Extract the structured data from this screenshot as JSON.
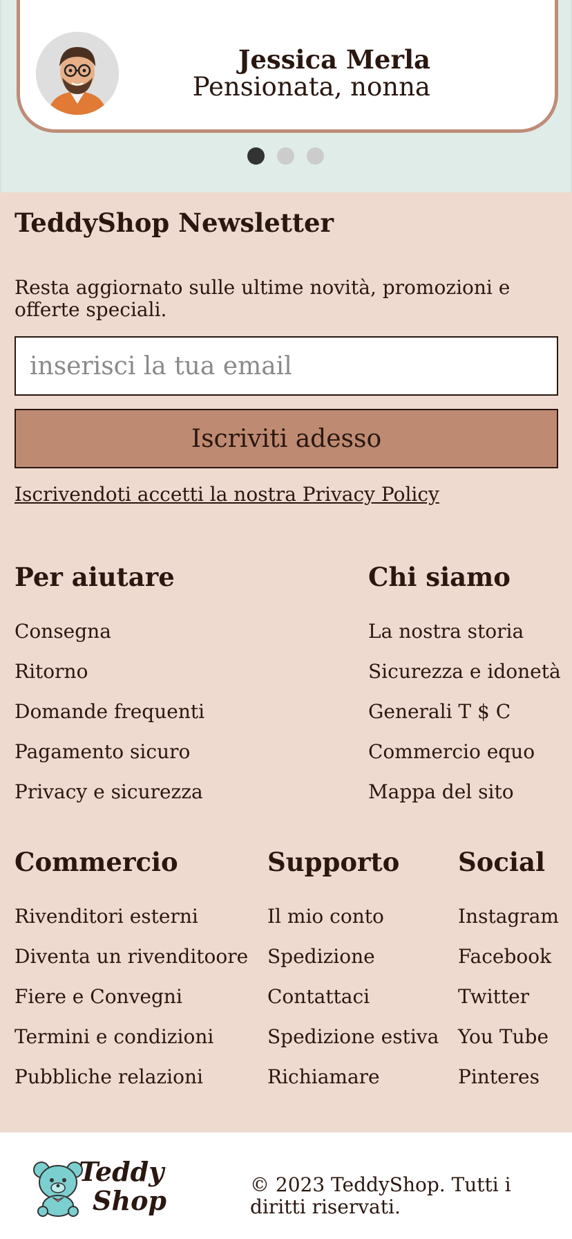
{
  "testimonial": {
    "name": "Jessica Merla",
    "role": "Pensionata, nonna",
    "dots": 3,
    "active_dot": 0
  },
  "newsletter": {
    "title": "TeddyShop Newsletter",
    "text": "Resta aggiornato sulle ultime novità, promozioni e offerte speciali.",
    "email_placeholder": "inserisci la tua email",
    "button_label": "Iscriviti adesso",
    "privacy_text": "Iscrivendoti accetti la nostra Privacy Policy"
  },
  "footer_columns": {
    "per_aiutare": {
      "title": "Per aiutare",
      "items": [
        "Consegna",
        "Ritorno",
        "Domande frequenti",
        "Pagamento sicuro",
        "Privacy e sicurezza"
      ]
    },
    "chi_siamo": {
      "title": "Chi siamo",
      "items": [
        "La nostra storia",
        "Sicurezza e idonetà",
        "Generali T $ C",
        "Commercio equo",
        "Mappa del sito"
      ]
    },
    "commercio": {
      "title": "Commercio",
      "items": [
        "Rivenditori esterni",
        "Diventa un rivenditoore",
        "Fiere e Convegni",
        "Termini e condizioni",
        "Pubbliche relazioni"
      ]
    },
    "supporto": {
      "title": "Supporto",
      "items": [
        "Il mio conto",
        "Spedizione",
        "Contattaci",
        "Spedizione estiva",
        "Richiamare"
      ]
    },
    "social": {
      "title": "Social",
      "items": [
        "Instagram",
        "Facebook",
        "Twitter",
        "You Tube",
        "Pinteres"
      ]
    }
  },
  "bottom_bar": {
    "logo_line1": "Teddy",
    "logo_line2": "Shop",
    "copyright": "© 2023 TeddyShop. Tutti i diritti riservati."
  },
  "colors": {
    "section_bg": "#efdad0",
    "testimonial_bg": "#e0ece8",
    "accent": "#be8b72",
    "text": "#2a1710",
    "logo_bear": "#7ccfcf"
  }
}
